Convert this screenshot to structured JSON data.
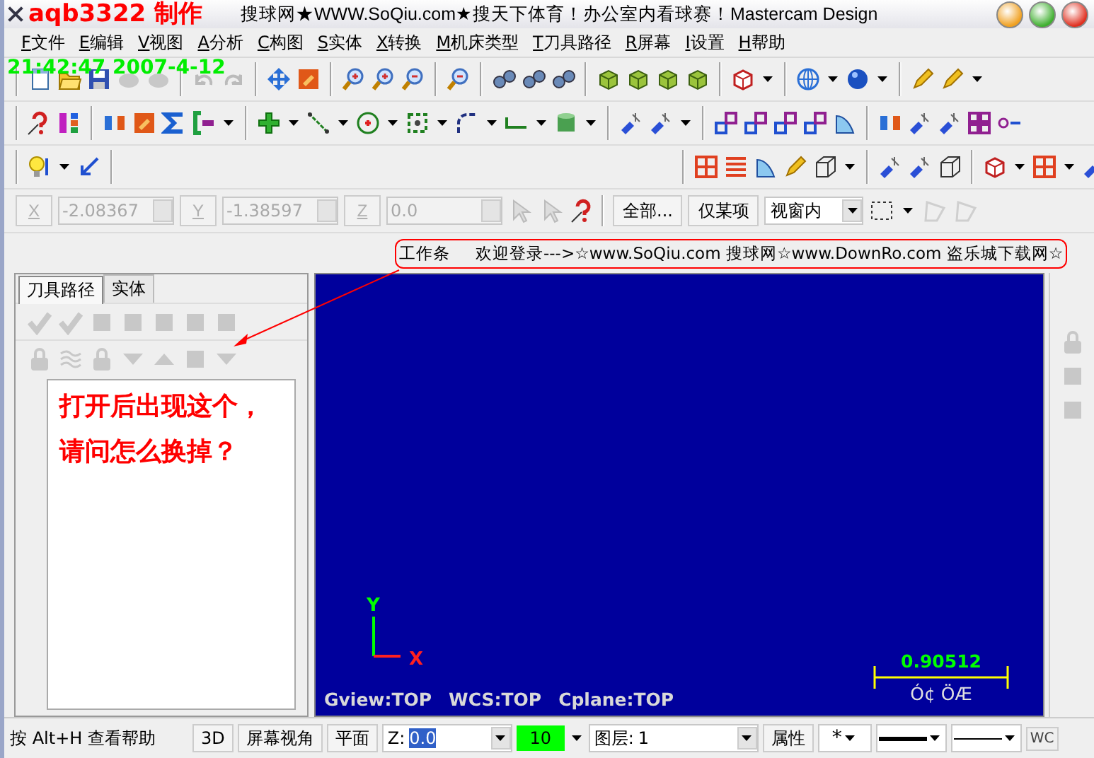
{
  "window": {
    "title": "搜球网★WWW.SoQiu.com★搜天下体育！办公室内看球赛！Mastercam Design"
  },
  "overlay": {
    "author": "aqb3322 制作",
    "timestamp": "21:42:47 2007-4-12"
  },
  "menu": [
    {
      "accel": "F",
      "label": "文件"
    },
    {
      "accel": "E",
      "label": "编辑"
    },
    {
      "accel": "V",
      "label": "视图"
    },
    {
      "accel": "A",
      "label": "分析"
    },
    {
      "accel": "C",
      "label": "构图"
    },
    {
      "accel": "S",
      "label": "实体"
    },
    {
      "accel": "X",
      "label": "转换"
    },
    {
      "accel": "M",
      "label": "机床类型"
    },
    {
      "accel": "T",
      "label": "刀具路径"
    },
    {
      "accel": "R",
      "label": "屏幕"
    },
    {
      "accel": "I",
      "label": "设置"
    },
    {
      "accel": "H",
      "label": "帮助"
    }
  ],
  "coordinates": [
    {
      "axis": "X",
      "value": "-2.08367",
      "disabled": true
    },
    {
      "axis": "Y",
      "value": "-1.38597",
      "disabled": true
    },
    {
      "axis": "Z",
      "value": "0.0",
      "disabled": true
    }
  ],
  "selection": {
    "buttons": [
      "全部...",
      "仅某项"
    ],
    "mode": "视窗内"
  },
  "workbar": {
    "label": "工作条",
    "message": "欢迎登录--->☆www.SoQiu.com 搜球网☆www.DownRo.com 盗乐城下载网☆"
  },
  "panel": {
    "tabs": [
      {
        "label": "刀具路径",
        "selected": true
      },
      {
        "label": "实体",
        "selected": false
      }
    ]
  },
  "annotation": {
    "lines": [
      "打开后出现这个，",
      "请问怎么换掉？"
    ]
  },
  "viewport": {
    "axis_y": "Y",
    "axis_x": "X",
    "views": [
      "Gview:TOP",
      "WCS:TOP",
      "Cplane:TOP"
    ],
    "scale_value": "0.90512",
    "scale_unit": "Ó¢ ÖÆ"
  },
  "status_bar": {
    "help": "按 Alt+H 查看帮助",
    "buttons": [
      "3D",
      "屏幕视角",
      "平面"
    ],
    "z_label": "Z:",
    "z_value": "0.0",
    "z_highlighted": true,
    "color_value": "10",
    "color": "#00ff00",
    "layer_label": "图层:",
    "layer_value": "1",
    "attributes": "属性",
    "point_style": "*",
    "wcs": "WC"
  }
}
